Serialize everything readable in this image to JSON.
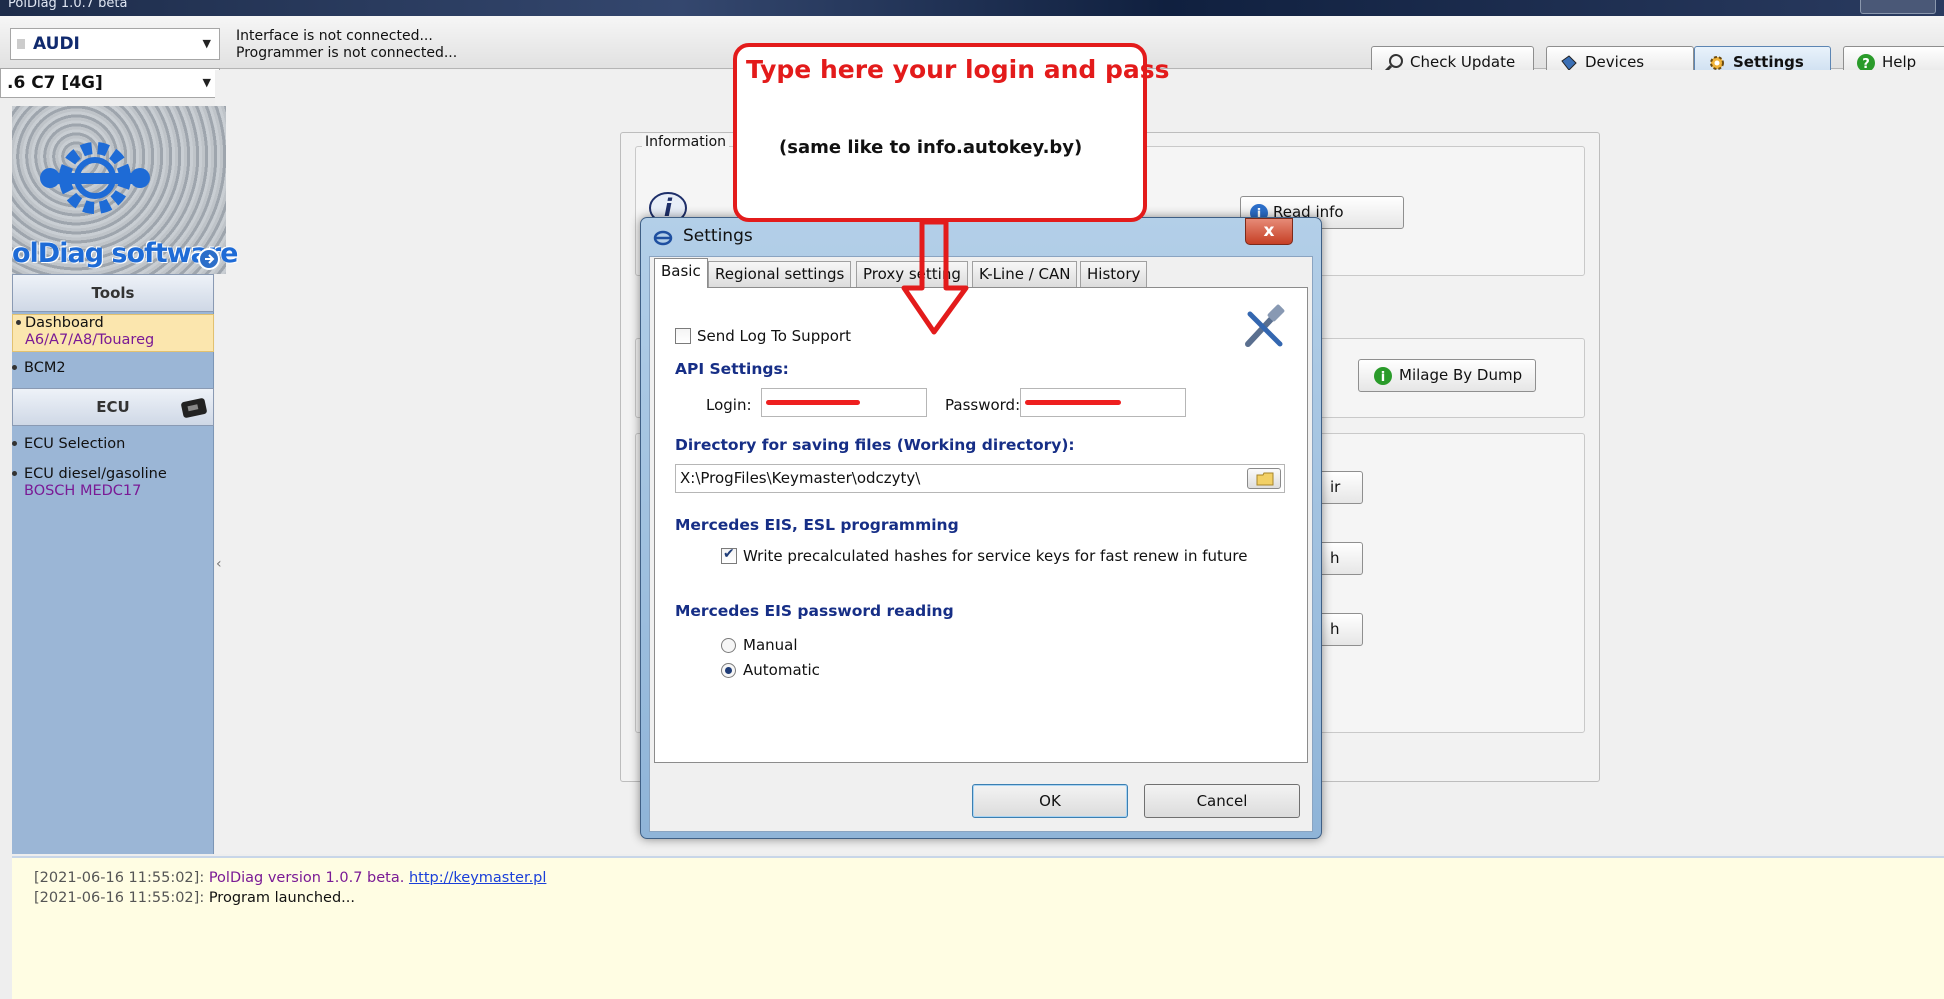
{
  "window": {
    "title": "PolDiag 1.0.7 beta"
  },
  "toolbar": {
    "brand": "AUDI",
    "model": ".6 C7 [4G]",
    "status_line1": "Interface is not connected...",
    "status_line2": "Programmer is not connected...",
    "check_update": "Check Update",
    "devices": "Devices",
    "settings": "Settings",
    "help": "Help"
  },
  "sidebar": {
    "logo_text": "olDiag software",
    "tools_header": "Tools",
    "items": [
      {
        "label": "Dashboard",
        "sub": "A6/A7/A8/Touareg"
      },
      {
        "label": "BCM2",
        "sub": ""
      }
    ],
    "ecu_header": "ECU",
    "ecu_items": [
      {
        "label": "ECU Selection",
        "sub": ""
      },
      {
        "label": "ECU diesel/gasoline",
        "sub": "BOSCH MEDC17"
      }
    ]
  },
  "main": {
    "information_label": "Information",
    "read_info": "Read info",
    "milage_by_dump": "Milage By Dump",
    "btn_partial_1": "ir",
    "btn_partial_2": "h",
    "btn_partial_3": "h"
  },
  "dialog": {
    "title": "Settings",
    "close": "x",
    "tabs": [
      "Basic",
      "Regional settings",
      "Proxy setting",
      "K-Line / CAN",
      "History"
    ],
    "send_log": "Send Log To Support",
    "api_settings": "API Settings:",
    "login_label": "Login:",
    "password_label": "Password:",
    "directory_label": "Directory for saving files (Working directory):",
    "directory_value": "X:\\ProgFiles\\Keymaster\\odczyty\\",
    "mercedes_eis_esl": "Mercedes EIS, ESL programming",
    "write_hashes": "Write precalculated hashes for service keys for fast renew in future",
    "mercedes_pw_reading": "Mercedes EIS password reading",
    "manual": "Manual",
    "automatic": "Automatic",
    "ok": "OK",
    "cancel": "Cancel",
    "state": {
      "send_log_checked": false,
      "write_hashes_checked": true,
      "password_mode": "Automatic"
    }
  },
  "callout": {
    "line1": "Type here your login and pass",
    "line2": "(same like to info.autokey.by)"
  },
  "log": [
    {
      "time": "[2021-06-16 11:55:02]:",
      "message": "PolDiag version 1.0.7 beta.",
      "link": "http://keymaster.pl"
    },
    {
      "time": "[2021-06-16 11:55:02]:",
      "message": "Program launched...",
      "link": ""
    }
  ],
  "colors": {
    "accent_red": "#e31b1b",
    "section_blue": "#162e86",
    "sidebar_blue": "#9bb6d6",
    "log_bg": "#fffde3"
  }
}
